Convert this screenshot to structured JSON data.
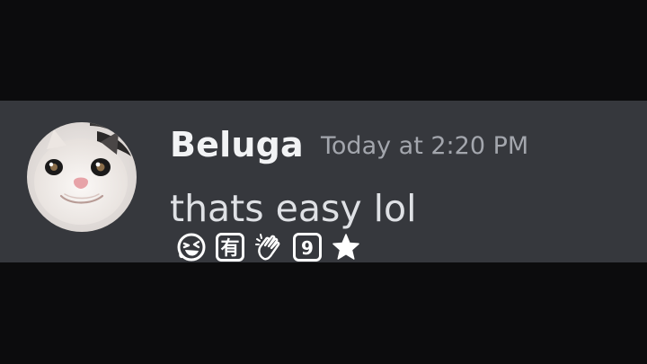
{
  "message": {
    "author": "Beluga",
    "timestamp": "Today at 2:20 PM",
    "text": "thats easy lol",
    "avatar_icon": "cat-avatar"
  },
  "badges": {
    "items": [
      {
        "icon": "laughing-face-icon"
      },
      {
        "icon": "kanji-badge-icon",
        "text": "有"
      },
      {
        "icon": "clapping-hands-icon"
      },
      {
        "icon": "number-badge-icon",
        "text": "9"
      },
      {
        "icon": "star-icon"
      }
    ]
  },
  "colors": {
    "page_background": "#0c0c0d",
    "message_background": "#36383d",
    "author": "#f2f3f5",
    "timestamp": "#a3a6ad",
    "text": "#dfe1e5",
    "badge": "#ffffff"
  }
}
